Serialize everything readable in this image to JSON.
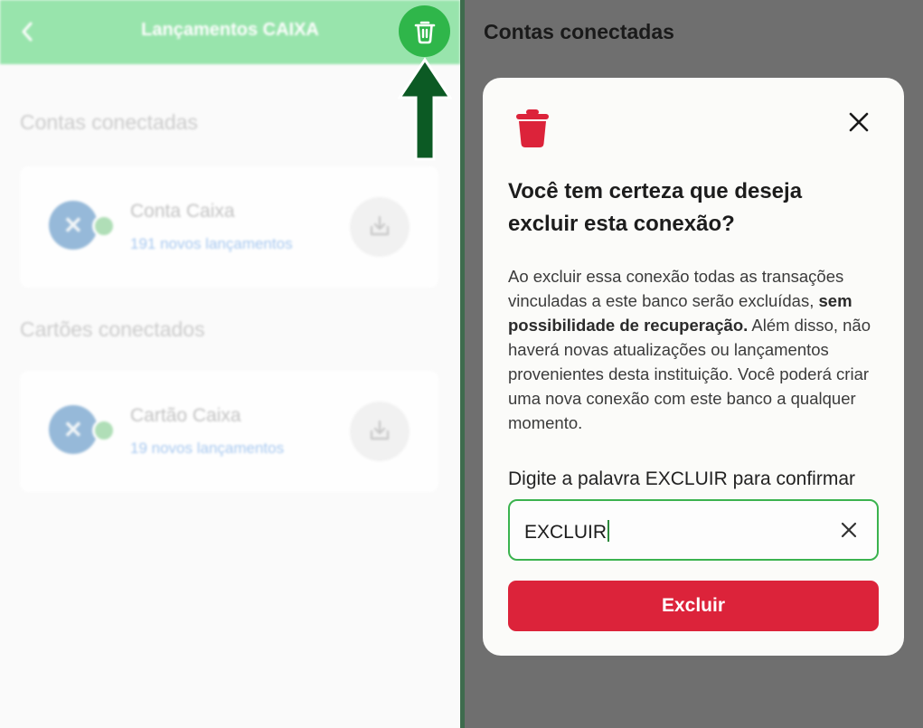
{
  "header": {
    "title": "Lançamentos CAIXA"
  },
  "sections": [
    {
      "title": "Contas conectadas",
      "item": {
        "name": "Conta Caixa",
        "subtitle": "191 novos lançamentos"
      }
    },
    {
      "title": "Cartões conectados",
      "item": {
        "name": "Cartão Caixa",
        "subtitle": "19 novos lançamentos"
      }
    }
  ],
  "right": {
    "page_title": "Contas conectadas"
  },
  "modal": {
    "heading": "Você tem certeza que deseja excluir esta conexão?",
    "body_pre": "Ao excluir essa conexão todas as transações vinculadas a este banco serão excluídas, ",
    "body_bold": "sem possibilidade de recuperação.",
    "body_post": " Além disso, não haverá novas atualizações ou lançamentos provenientes desta instituição. Você poderá criar uma nova conexão com este banco a qualquer momento.",
    "confirm_label": "Digite a palavra EXCLUIR para confirmar",
    "confirm_value": "EXCLUIR",
    "submit_label": "Excluir"
  },
  "colors": {
    "brand_green": "#2fb64a",
    "header_green": "#8ee2a4",
    "danger_red": "#dc233a",
    "arrow_green": "#0c5a24"
  },
  "icons": {
    "back": "chevron-left-icon",
    "delete": "trash-icon",
    "download": "download-icon",
    "close": "close-icon",
    "clear": "clear-icon",
    "annotation": "arrow-up-icon"
  }
}
